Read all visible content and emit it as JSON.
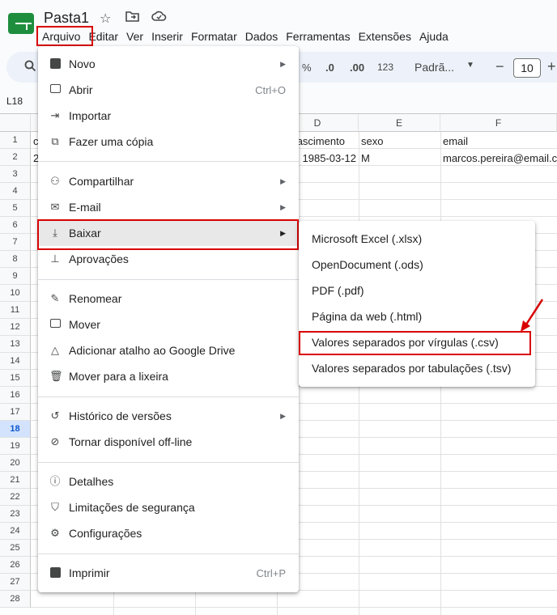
{
  "doc": {
    "title": "Pasta1"
  },
  "menubar": {
    "items": [
      "Arquivo",
      "Editar",
      "Ver",
      "Inserir",
      "Formatar",
      "Dados",
      "Ferramentas",
      "Extensões",
      "Ajuda"
    ]
  },
  "toolbar": {
    "percent": "%",
    "dec_decrease": ".0",
    "dec_increase": ".00",
    "format_123": "123",
    "font": "Padrã...",
    "minus": "−",
    "font_size": "10",
    "plus": "+"
  },
  "cell_ref": "L18",
  "columns": [
    "D",
    "E",
    "F"
  ],
  "rows": [
    "1",
    "2",
    "3",
    "4",
    "5",
    "6",
    "7",
    "8",
    "9",
    "10",
    "11",
    "12",
    "13",
    "14",
    "15",
    "16",
    "17",
    "18",
    "19",
    "20",
    "21",
    "22",
    "23",
    "24",
    "25",
    "26",
    "27",
    "28"
  ],
  "cells": {
    "a1": "c",
    "a2": "2",
    "d1": "a_nascimento",
    "d2": "1985-03-12",
    "e1": "sexo",
    "e2": "M",
    "f1": "email",
    "f2": "marcos.pereira@email.c"
  },
  "menu": {
    "novo": "Novo",
    "abrir": "Abrir",
    "abrir_sc": "Ctrl+O",
    "importar": "Importar",
    "copia": "Fazer uma cópia",
    "compartilhar": "Compartilhar",
    "email": "E-mail",
    "baixar": "Baixar",
    "aprovacoes": "Aprovações",
    "renomear": "Renomear",
    "mover": "Mover",
    "atalho": "Adicionar atalho ao Google Drive",
    "lixeira": "Mover para a lixeira",
    "historico": "Histórico de versões",
    "offline": "Tornar disponível off-line",
    "detalhes": "Detalhes",
    "seguranca": "Limitações de segurança",
    "config": "Configurações",
    "imprimir": "Imprimir",
    "imprimir_sc": "Ctrl+P"
  },
  "submenu": {
    "xlsx": "Microsoft Excel (.xlsx)",
    "ods": "OpenDocument (.ods)",
    "pdf": "PDF (.pdf)",
    "html": "Página da web (.html)",
    "csv": "Valores separados por vírgulas (.csv)",
    "tsv": "Valores separados por tabulações (.tsv)"
  },
  "colors": {
    "highlight": "#d90000",
    "sheets_green": "#1e8e3e",
    "selected_row": "#d3e3fd"
  }
}
